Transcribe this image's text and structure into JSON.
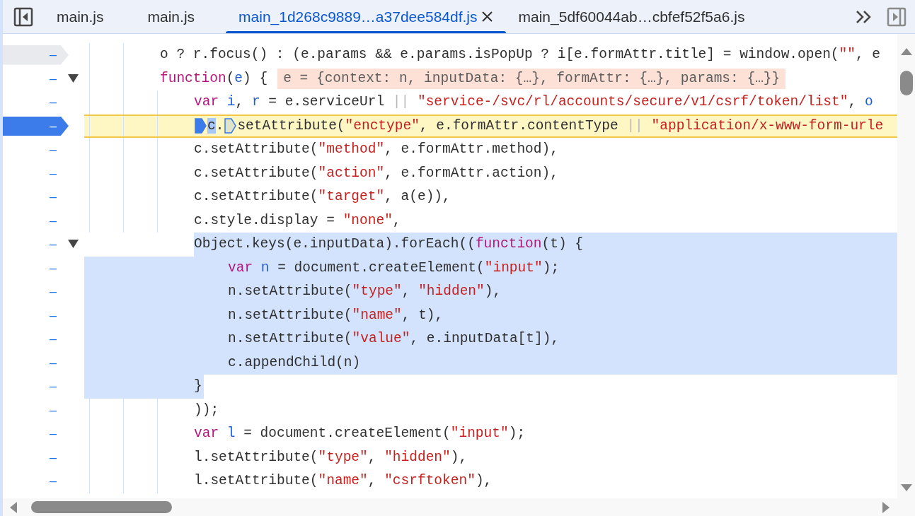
{
  "tabs": [
    {
      "label": "main.js",
      "selected": false,
      "closable": false
    },
    {
      "label": "main.js",
      "selected": false,
      "closable": false
    },
    {
      "label": "main_1d268c9889…a37dee584df.js",
      "selected": true,
      "closable": true
    },
    {
      "label": "main_5df60044ab…cbfef52f5a6.js",
      "selected": false,
      "closable": false
    }
  ],
  "lines": [
    {
      "number": "–",
      "breakpoint": {
        "enabled": false
      },
      "paused": false,
      "selected": false,
      "tokens": [
        {
          "kind": "plain",
          "text": "o ? r.focus() : (e.params && e.params.isPopUp ? i[e.formAttr.title] = window.open("
        },
        {
          "kind": "str",
          "text": "\"\""
        },
        {
          "kind": "plain",
          "text": ", e"
        }
      ]
    },
    {
      "number": "–",
      "paused": false,
      "selected": false,
      "expanded": true,
      "tokens": [
        {
          "kind": "kw",
          "text": "function"
        },
        {
          "kind": "plain",
          "text": "("
        },
        {
          "kind": "var",
          "text": "e"
        },
        {
          "kind": "plain",
          "text": ") {"
        }
      ],
      "inline_value": "e = {context: n, inputData: {…}, formAttr: {…}, params: {…}}",
      "children": [
        {
          "number": "–",
          "paused": false,
          "selected": false,
          "tokens": [
            {
              "kind": "kw",
              "text": "var "
            },
            {
              "kind": "var",
              "text": "i"
            },
            {
              "kind": "plain",
              "text": ", "
            },
            {
              "kind": "var",
              "text": "r"
            },
            {
              "kind": "plain",
              "text": " = e.serviceUrl "
            },
            {
              "kind": "op",
              "text": "|| "
            },
            {
              "kind": "str",
              "text": "\"service-/svc/rl/accounts/secure/v1/csrf/token/list\""
            },
            {
              "kind": "plain",
              "text": ", "
            },
            {
              "kind": "var",
              "text": "o"
            }
          ]
        },
        {
          "number": "–",
          "breakpoint": {
            "enabled": true
          },
          "paused": true,
          "selected": false,
          "tokens": [
            {
              "kind": "marker",
              "active": true
            },
            {
              "kind": "current",
              "text": "c"
            },
            {
              "kind": "plain",
              "text": "."
            },
            {
              "kind": "marker",
              "active": false
            },
            {
              "kind": "plain",
              "text": "setAttribute("
            },
            {
              "kind": "str",
              "text": "\"enctype\""
            },
            {
              "kind": "plain",
              "text": ", e.formAttr.contentType "
            },
            {
              "kind": "op",
              "text": "|| "
            },
            {
              "kind": "str",
              "text": "\"application/x-www-form-urle"
            }
          ]
        },
        {
          "number": "–",
          "paused": false,
          "selected": false,
          "tokens": [
            {
              "kind": "plain",
              "text": "c.setAttribute("
            },
            {
              "kind": "str",
              "text": "\"method\""
            },
            {
              "kind": "plain",
              "text": ", e.formAttr.method),"
            }
          ]
        },
        {
          "number": "–",
          "paused": false,
          "selected": false,
          "tokens": [
            {
              "kind": "plain",
              "text": "c.setAttribute("
            },
            {
              "kind": "str",
              "text": "\"action\""
            },
            {
              "kind": "plain",
              "text": ", e.formAttr.action),"
            }
          ]
        },
        {
          "number": "–",
          "paused": false,
          "selected": false,
          "tokens": [
            {
              "kind": "plain",
              "text": "c.setAttribute("
            },
            {
              "kind": "str",
              "text": "\"target\""
            },
            {
              "kind": "plain",
              "text": ", a(e)),"
            }
          ]
        },
        {
          "number": "–",
          "paused": false,
          "selected": false,
          "tokens": [
            {
              "kind": "plain",
              "text": "c.style.display = "
            },
            {
              "kind": "str",
              "text": "\"none\""
            },
            {
              "kind": "plain",
              "text": ","
            }
          ]
        },
        {
          "number": "–",
          "paused": false,
          "selected": true,
          "expanded": true,
          "tokens": [
            {
              "kind": "plain",
              "text": "Object.keys(e.inputData).forEach(("
            },
            {
              "kind": "kw",
              "text": "function"
            },
            {
              "kind": "plain",
              "text": "(t) {"
            }
          ],
          "children": [
            {
              "number": "–",
              "paused": false,
              "selected": true,
              "tokens": [
                {
                  "kind": "kw",
                  "text": "var "
                },
                {
                  "kind": "var",
                  "text": "n"
                },
                {
                  "kind": "plain",
                  "text": " = document.createElement("
                },
                {
                  "kind": "str",
                  "text": "\"input\""
                },
                {
                  "kind": "plain",
                  "text": ");"
                }
              ]
            },
            {
              "number": "–",
              "paused": false,
              "selected": true,
              "tokens": [
                {
                  "kind": "plain",
                  "text": "n.setAttribute("
                },
                {
                  "kind": "str",
                  "text": "\"type\""
                },
                {
                  "kind": "plain",
                  "text": ", "
                },
                {
                  "kind": "str",
                  "text": "\"hidden\""
                },
                {
                  "kind": "plain",
                  "text": "),"
                }
              ]
            },
            {
              "number": "–",
              "paused": false,
              "selected": true,
              "tokens": [
                {
                  "kind": "plain",
                  "text": "n.setAttribute("
                },
                {
                  "kind": "str",
                  "text": "\"name\""
                },
                {
                  "kind": "plain",
                  "text": ", t),"
                }
              ]
            },
            {
              "number": "–",
              "paused": false,
              "selected": true,
              "tokens": [
                {
                  "kind": "plain",
                  "text": "n.setAttribute("
                },
                {
                  "kind": "str",
                  "text": "\"value\""
                },
                {
                  "kind": "plain",
                  "text": ", e.inputData[t]),"
                }
              ]
            },
            {
              "number": "–",
              "paused": false,
              "selected": true,
              "tokens": [
                {
                  "kind": "plain",
                  "text": "c.appendChild(n)"
                }
              ]
            }
          ]
        },
        {
          "number": "–",
          "paused": false,
          "selected": true,
          "tokens": [
            {
              "kind": "plain",
              "text": "}"
            }
          ]
        },
        {
          "number": "–",
          "paused": false,
          "selected": false,
          "tokens": [
            {
              "kind": "plain",
              "text": "));"
            }
          ]
        },
        {
          "number": "–",
          "paused": false,
          "selected": false,
          "tokens": [
            {
              "kind": "kw",
              "text": "var "
            },
            {
              "kind": "var",
              "text": "l"
            },
            {
              "kind": "plain",
              "text": " = document.createElement("
            },
            {
              "kind": "str",
              "text": "\"input\""
            },
            {
              "kind": "plain",
              "text": ");"
            }
          ]
        },
        {
          "number": "–",
          "paused": false,
          "selected": false,
          "tokens": [
            {
              "kind": "plain",
              "text": "l.setAttribute("
            },
            {
              "kind": "str",
              "text": "\"type\""
            },
            {
              "kind": "plain",
              "text": ", "
            },
            {
              "kind": "str",
              "text": "\"hidden\""
            },
            {
              "kind": "plain",
              "text": "),"
            }
          ]
        },
        {
          "number": "–",
          "paused": false,
          "selected": false,
          "tokens": [
            {
              "kind": "plain",
              "text": "l.setAttribute("
            },
            {
              "kind": "str",
              "text": "\"name\""
            },
            {
              "kind": "plain",
              "text": ", "
            },
            {
              "kind": "str",
              "text": "\"csrftoken\""
            },
            {
              "kind": "plain",
              "text": "),"
            }
          ]
        }
      ]
    }
  ]
}
